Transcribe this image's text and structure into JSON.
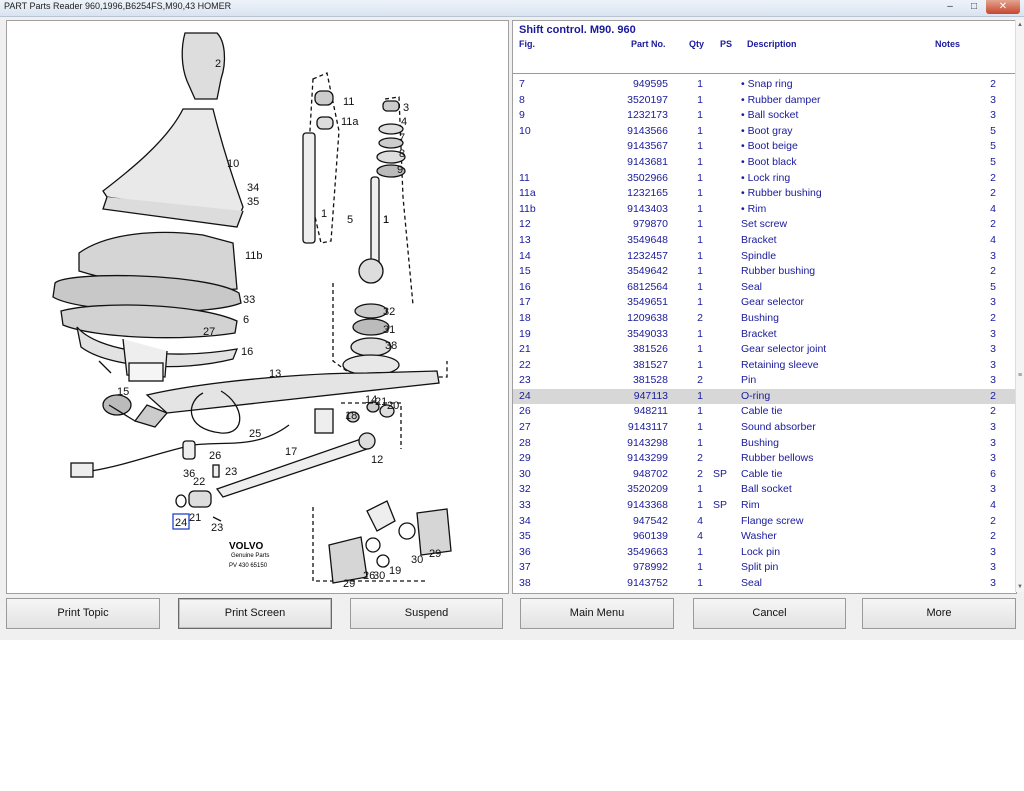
{
  "window": {
    "title": "PART Parts Reader 960,1996,B6254FS,M90,43 HOMER"
  },
  "diagram": {
    "callouts": [
      "2",
      "10",
      "34",
      "35",
      "11b",
      "33",
      "6",
      "27",
      "16",
      "15",
      "13",
      "18",
      "14",
      "21",
      "20",
      "25",
      "26",
      "17",
      "12",
      "36",
      "23",
      "22",
      "24",
      "21",
      "23",
      "11",
      "11a",
      "1",
      "3",
      "4",
      "7",
      "8",
      "9",
      "1",
      "5",
      "1",
      "32",
      "31",
      "38",
      "29",
      "30",
      "19",
      "26",
      "30",
      "29"
    ],
    "brand": "VOLVO",
    "brand_sub": "Genuine Parts",
    "part_code": "PV  430 65150",
    "selected_fig": "24"
  },
  "parts_list": {
    "title": "Shift control. M90. 960",
    "columns": {
      "fig": "Fig.",
      "part": "Part No.",
      "qty": "Qty",
      "ps": "PS",
      "desc": "Description",
      "notes": "Notes"
    },
    "rows": [
      {
        "fig": "7",
        "part": "949595",
        "qty": "1",
        "ps": "",
        "desc": "• Snap ring",
        "notes": "2"
      },
      {
        "fig": "8",
        "part": "3520197",
        "qty": "1",
        "ps": "",
        "desc": "• Rubber damper",
        "notes": "3"
      },
      {
        "fig": "9",
        "part": "1232173",
        "qty": "1",
        "ps": "",
        "desc": "• Ball socket",
        "notes": "3"
      },
      {
        "fig": "10",
        "part": "9143566",
        "qty": "1",
        "ps": "",
        "desc": "• Boot gray",
        "notes": "5"
      },
      {
        "fig": "",
        "part": "9143567",
        "qty": "1",
        "ps": "",
        "desc": "• Boot beige",
        "notes": "5"
      },
      {
        "fig": "",
        "part": "9143681",
        "qty": "1",
        "ps": "",
        "desc": "• Boot black",
        "notes": "5"
      },
      {
        "fig": "11",
        "part": "3502966",
        "qty": "1",
        "ps": "",
        "desc": "• Lock ring",
        "notes": "2"
      },
      {
        "fig": "11a",
        "part": "1232165",
        "qty": "1",
        "ps": "",
        "desc": "• Rubber bushing",
        "notes": "2"
      },
      {
        "fig": "11b",
        "part": "9143403",
        "qty": "1",
        "ps": "",
        "desc": "• Rim",
        "notes": "4"
      },
      {
        "fig": "12",
        "part": "979870",
        "qty": "1",
        "ps": "",
        "desc": "Set screw",
        "notes": "2"
      },
      {
        "fig": "13",
        "part": "3549648",
        "qty": "1",
        "ps": "",
        "desc": "Bracket",
        "notes": "4"
      },
      {
        "fig": "14",
        "part": "1232457",
        "qty": "1",
        "ps": "",
        "desc": "Spindle",
        "notes": "3"
      },
      {
        "fig": "15",
        "part": "3549642",
        "qty": "1",
        "ps": "",
        "desc": "Rubber bushing",
        "notes": "2"
      },
      {
        "fig": "16",
        "part": "6812564",
        "qty": "1",
        "ps": "",
        "desc": "Seal",
        "notes": "5"
      },
      {
        "fig": "17",
        "part": "3549651",
        "qty": "1",
        "ps": "",
        "desc": "Gear selector",
        "notes": "3"
      },
      {
        "fig": "18",
        "part": "1209638",
        "qty": "2",
        "ps": "",
        "desc": "Bushing",
        "notes": "2"
      },
      {
        "fig": "19",
        "part": "3549033",
        "qty": "1",
        "ps": "",
        "desc": "Bracket",
        "notes": "3"
      },
      {
        "fig": "21",
        "part": "381526",
        "qty": "1",
        "ps": "",
        "desc": "Gear selector joint",
        "notes": "3"
      },
      {
        "fig": "22",
        "part": "381527",
        "qty": "1",
        "ps": "",
        "desc": "Retaining sleeve",
        "notes": "3"
      },
      {
        "fig": "23",
        "part": "381528",
        "qty": "2",
        "ps": "",
        "desc": "Pin",
        "notes": "3"
      },
      {
        "fig": "24",
        "part": "947113",
        "qty": "1",
        "ps": "",
        "desc": "O-ring",
        "notes": "2",
        "selected": true
      },
      {
        "fig": "26",
        "part": "948211",
        "qty": "1",
        "ps": "",
        "desc": "Cable tie",
        "notes": "2"
      },
      {
        "fig": "27",
        "part": "9143117",
        "qty": "1",
        "ps": "",
        "desc": "Sound absorber",
        "notes": "3"
      },
      {
        "fig": "28",
        "part": "9143298",
        "qty": "1",
        "ps": "",
        "desc": "Bushing",
        "notes": "3"
      },
      {
        "fig": "29",
        "part": "9143299",
        "qty": "2",
        "ps": "",
        "desc": "Rubber bellows",
        "notes": "3"
      },
      {
        "fig": "30",
        "part": "948702",
        "qty": "2",
        "ps": "SP",
        "desc": "Cable tie",
        "notes": "6"
      },
      {
        "fig": "32",
        "part": "3520209",
        "qty": "1",
        "ps": "",
        "desc": "Ball socket",
        "notes": "3"
      },
      {
        "fig": "33",
        "part": "9143368",
        "qty": "1",
        "ps": "SP",
        "desc": "Rim",
        "notes": "4"
      },
      {
        "fig": "34",
        "part": "947542",
        "qty": "4",
        "ps": "",
        "desc": "Flange screw",
        "notes": "2"
      },
      {
        "fig": "35",
        "part": "960139",
        "qty": "4",
        "ps": "",
        "desc": "Washer",
        "notes": "2"
      },
      {
        "fig": "36",
        "part": "3549663",
        "qty": "1",
        "ps": "",
        "desc": "Lock pin",
        "notes": "3"
      },
      {
        "fig": "37",
        "part": "978992",
        "qty": "1",
        "ps": "",
        "desc": "Split pin",
        "notes": "3"
      },
      {
        "fig": "38",
        "part": "9143752",
        "qty": "1",
        "ps": "",
        "desc": "Seal",
        "notes": "3"
      }
    ]
  },
  "buttons": {
    "print_topic": "Print Topic",
    "print_screen": "Print Screen",
    "suspend": "Suspend",
    "main_menu": "Main Menu",
    "cancel": "Cancel",
    "more": "More"
  },
  "colors": {
    "list_text": "#1a1a9c",
    "selected_row": "#d7d7d7"
  }
}
